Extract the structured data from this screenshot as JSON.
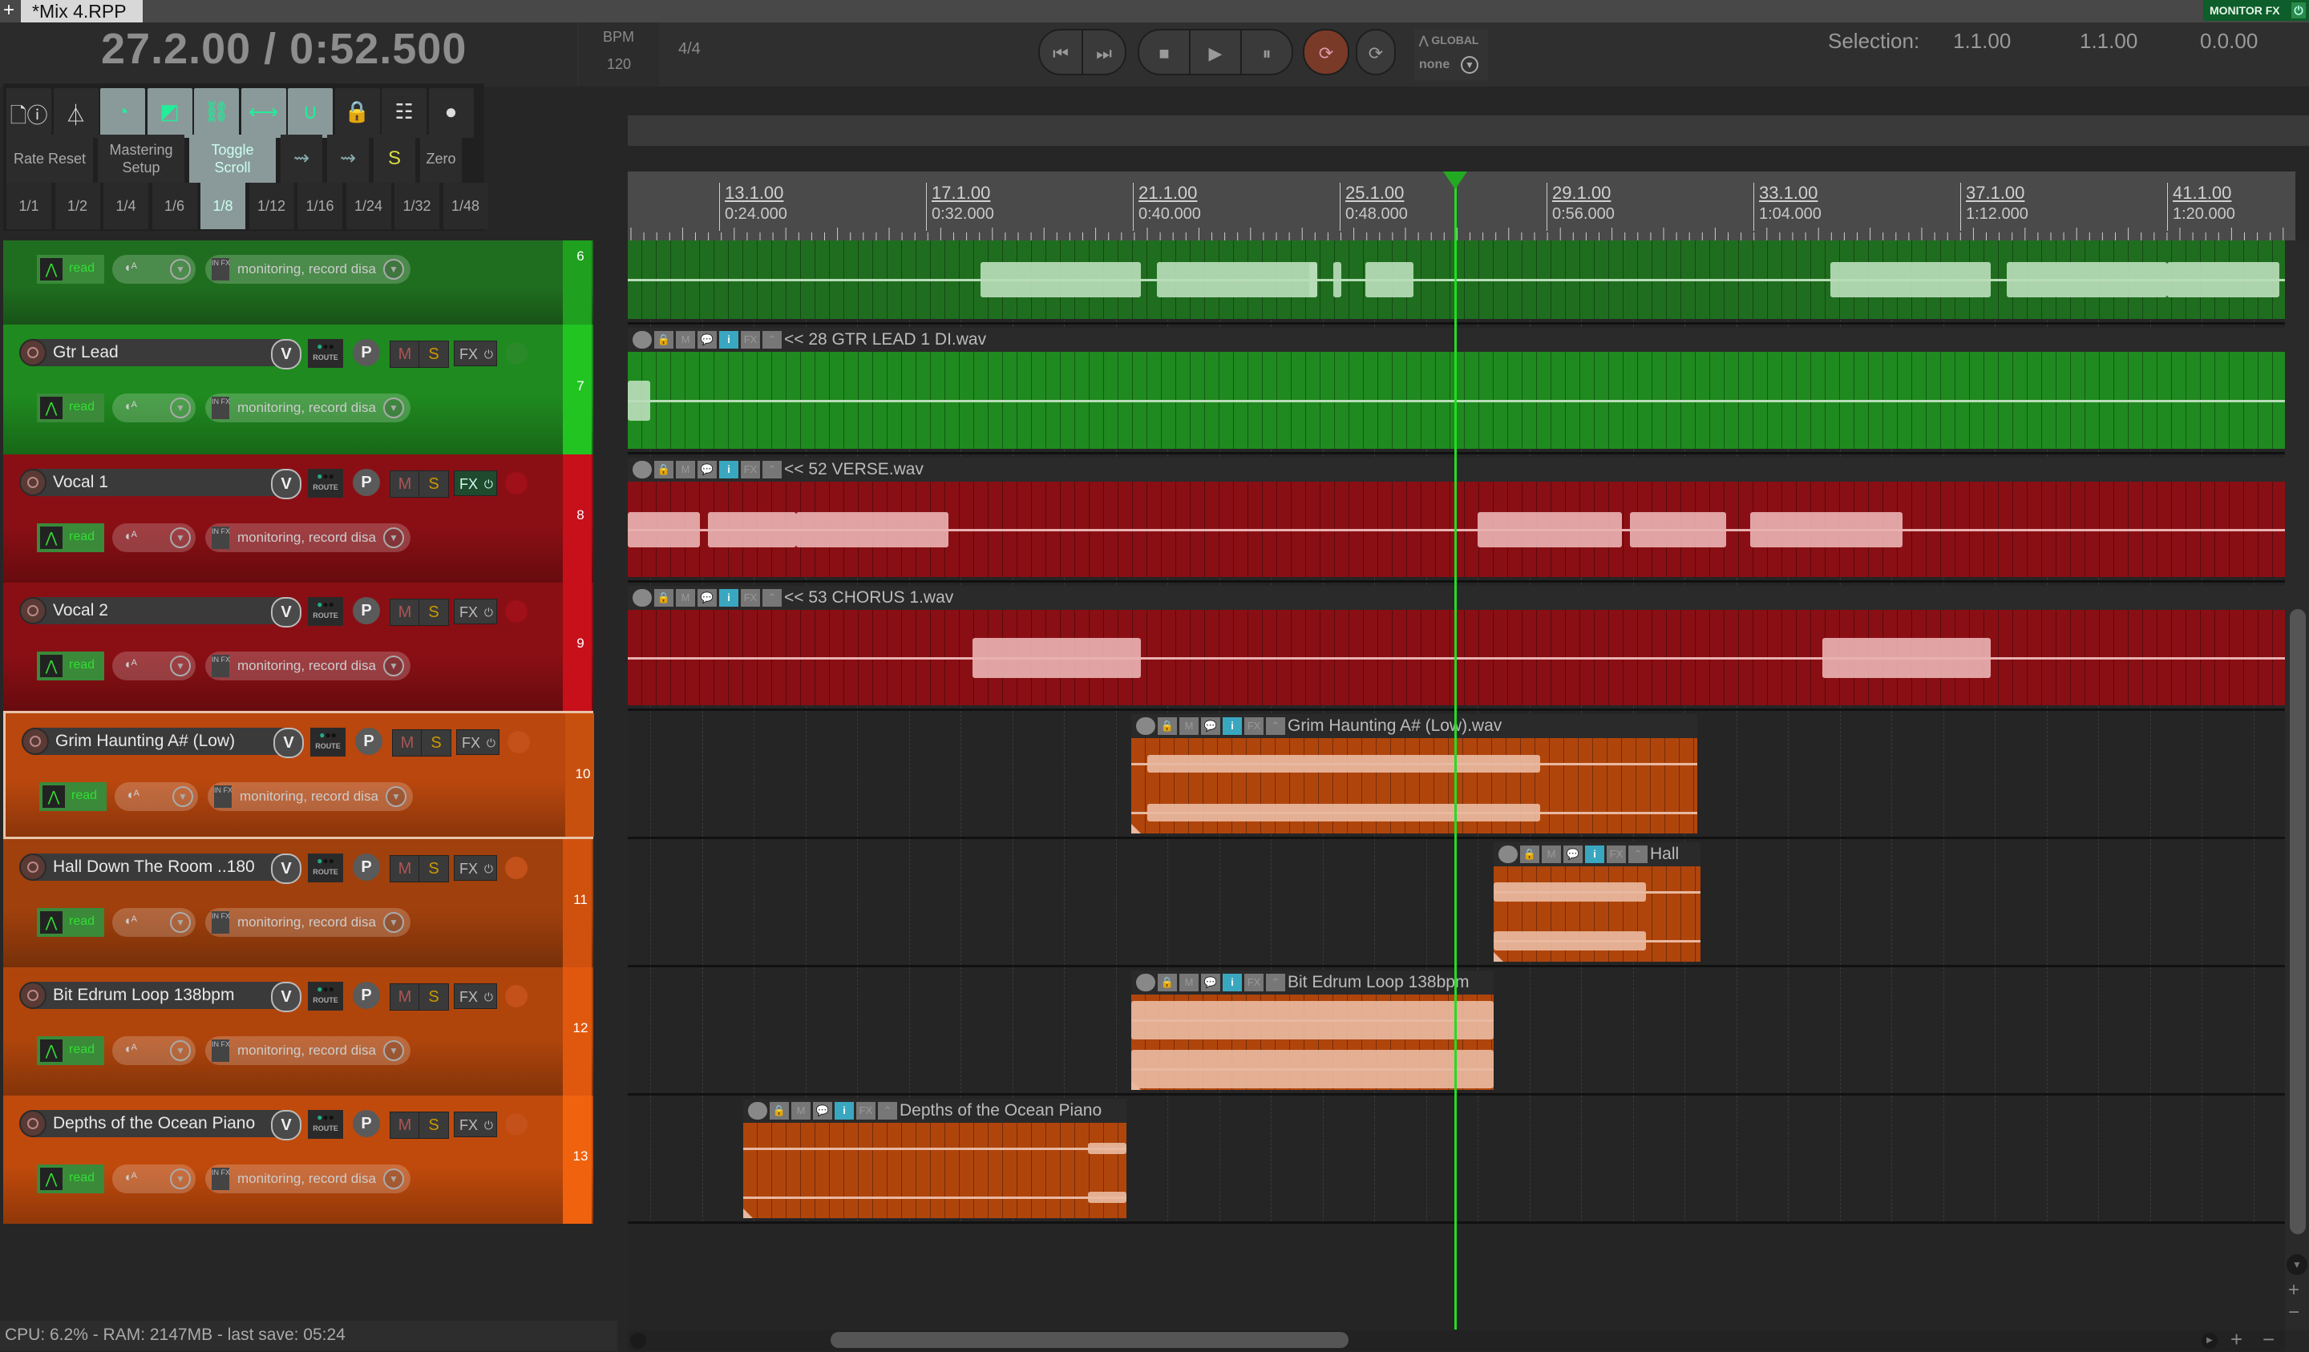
{
  "window": {
    "tab_plus": "+",
    "project_tab": "*Mix 4.RPP",
    "monitor_fx": "MONITOR FX",
    "monitor_fx_power": "⏻"
  },
  "transport": {
    "position": "27.2.00 / 0:52.500",
    "bpm_label": "BPM",
    "bpm": "120",
    "time_signature": "4/4",
    "buttons": {
      "go_start": "⏮",
      "go_end": "⏭",
      "stop": "■",
      "play": "▶",
      "pause": "⏸",
      "record": "⟳",
      "repeat": "⟳"
    },
    "automation_mode_label": "GLOBAL",
    "automation_mode_value": "none",
    "selection_label": "Selection:",
    "selection_start": "1.1.00",
    "selection_end": "1.1.00",
    "selection_length": "0.0.00"
  },
  "toolbar": {
    "icons": [
      {
        "name": "project-info-icon",
        "active": false
      },
      {
        "name": "metronome-icon",
        "active": false
      },
      {
        "name": "auto-record-icon",
        "active": true
      },
      {
        "name": "ripple-edit-icon",
        "active": true
      },
      {
        "name": "link-unlink-icon",
        "active": true
      },
      {
        "name": "envelope-move-icon",
        "active": true
      },
      {
        "name": "snap-magnet-icon",
        "active": true
      },
      {
        "name": "lock-settings-icon",
        "active": false
      },
      {
        "name": "mixer-grid-icon",
        "active": false
      },
      {
        "name": "record-stack-icon",
        "active": false
      }
    ],
    "text_buttons": [
      {
        "label": "Rate Reset",
        "active": false
      },
      {
        "label": "Mastering Setup",
        "active": false
      },
      {
        "label": "Toggle Scroll",
        "active": true
      },
      {
        "label": "",
        "icon": "envelope-follow-icon",
        "active": false
      },
      {
        "label": "",
        "icon": "envelope-follow-multi-icon",
        "active": false
      },
      {
        "label": "",
        "icon": "sd-badge-icon",
        "active": false
      },
      {
        "label": "Zero",
        "active": false
      }
    ],
    "grid_divisions": [
      "1/1",
      "1/2",
      "1/4",
      "1/6",
      "1/8",
      "1/12",
      "1/16",
      "1/24",
      "1/32",
      "1/48"
    ],
    "grid_selected": "1/8"
  },
  "ruler": {
    "markers": [
      {
        "bar": "13.1.00",
        "time": "0:24.000"
      },
      {
        "bar": "17.1.00",
        "time": "0:32.000"
      },
      {
        "bar": "21.1.00",
        "time": "0:40.000"
      },
      {
        "bar": "25.1.00",
        "time": "0:48.000"
      },
      {
        "bar": "29.1.00",
        "time": "0:56.000"
      },
      {
        "bar": "33.1.00",
        "time": "1:04.000"
      },
      {
        "bar": "37.1.00",
        "time": "1:12.000"
      },
      {
        "bar": "41.1.00",
        "time": "1:20.000"
      }
    ]
  },
  "tracks": [
    {
      "number": "6",
      "name": "",
      "color": "#1f6e1f",
      "strip": "#1fa01f",
      "automation": "read",
      "input": "monitoring, record disa",
      "partial": true
    },
    {
      "number": "7",
      "name": "Gtr Lead",
      "color": "#1f8a1f",
      "strip": "#22c422",
      "automation": "read",
      "input": "monitoring, record disa"
    },
    {
      "number": "8",
      "name": "Vocal 1",
      "color": "#8a0f14",
      "strip": "#c8101a",
      "automation": "read",
      "input": "monitoring, record disa",
      "fx_active": true
    },
    {
      "number": "9",
      "name": "Vocal 2",
      "color": "#8a0f14",
      "strip": "#c8101a",
      "automation": "read",
      "input": "monitoring, record disa"
    },
    {
      "number": "10",
      "name": "Grim Haunting A# (Low)",
      "color": "#b9470e",
      "strip": "#c8500e",
      "automation": "read",
      "input": "monitoring, record disa",
      "selected": true
    },
    {
      "number": "11",
      "name": "Hall Down The Room ..180",
      "color": "#a0400c",
      "strip": "#d0500e",
      "automation": "read",
      "input": "monitoring, record disa"
    },
    {
      "number": "12",
      "name": "Bit Edrum Loop 138bpm",
      "color": "#b0450c",
      "strip": "#e0580e",
      "automation": "read",
      "input": "monitoring, record disa"
    },
    {
      "number": "13",
      "name": "Depths of the Ocean Piano",
      "color": "#c04a0c",
      "strip": "#f0620e",
      "automation": "read",
      "input": "monitoring, record disa"
    }
  ],
  "items": [
    {
      "track": "6",
      "label": "",
      "color": "#1f6e1f"
    },
    {
      "track": "7",
      "label": "<< 28 GTR LEAD 1 DI.wav",
      "color": "#1f8a1f"
    },
    {
      "track": "8",
      "label": "<< 52 VERSE.wav",
      "color": "#8a0f14"
    },
    {
      "track": "9",
      "label": "<< 53 CHORUS 1.wav",
      "color": "#8a0f14"
    },
    {
      "track": "10",
      "label": "Grim Haunting A# (Low).wav",
      "color": "#b0450c"
    },
    {
      "track": "11",
      "label": "Hall",
      "color": "#b0450c"
    },
    {
      "track": "12",
      "label": "Bit Edrum Loop 138bpm",
      "color": "#b0450c"
    },
    {
      "track": "13",
      "label": "Depths of the Ocean Piano",
      "color": "#b0450c"
    }
  ],
  "item_buttons": {
    "lock": "🔒",
    "mute": "M",
    "notes": "💬",
    "info": "i",
    "fx": "FX",
    "envelope": "⌃"
  },
  "track_buttons": {
    "volume": "V",
    "pan": "P",
    "route": "ROUTE",
    "mute": "M",
    "solo": "S",
    "fx": "FX",
    "fx_power": "⏻",
    "in_fx": "IN FX",
    "dropdown": "▼",
    "pan_icon": "◖ᴬ"
  },
  "status": {
    "text": "CPU: 6.2% - RAM: 2147MB -  last save: 05:24"
  },
  "playhead": {
    "position": "27.2.00"
  },
  "colors": {
    "playhead": "#22dd22",
    "info_button": "#3aa7c0",
    "monitor_fx": "#0d5e2a"
  }
}
